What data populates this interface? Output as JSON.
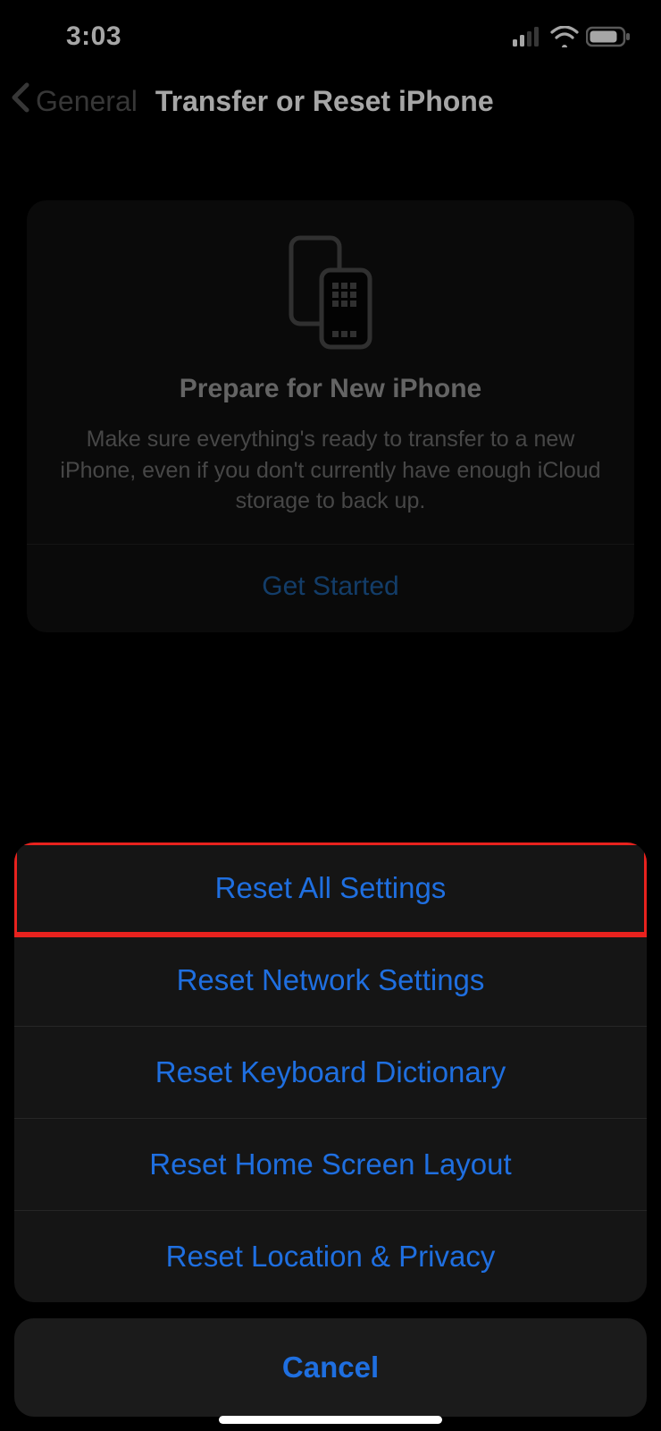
{
  "status": {
    "time": "3:03"
  },
  "nav": {
    "back_label": "General",
    "title": "Transfer or Reset iPhone"
  },
  "card": {
    "title": "Prepare for New iPhone",
    "description": "Make sure everything's ready to transfer to a new iPhone, even if you don't currently have enough iCloud storage to back up.",
    "action_label": "Get Started"
  },
  "sheet": {
    "items": [
      {
        "label": "Reset All Settings",
        "highlighted": true
      },
      {
        "label": "Reset Network Settings"
      },
      {
        "label": "Reset Keyboard Dictionary"
      },
      {
        "label": "Reset Home Screen Layout"
      },
      {
        "label": "Reset Location & Privacy"
      }
    ],
    "cancel_label": "Cancel"
  }
}
